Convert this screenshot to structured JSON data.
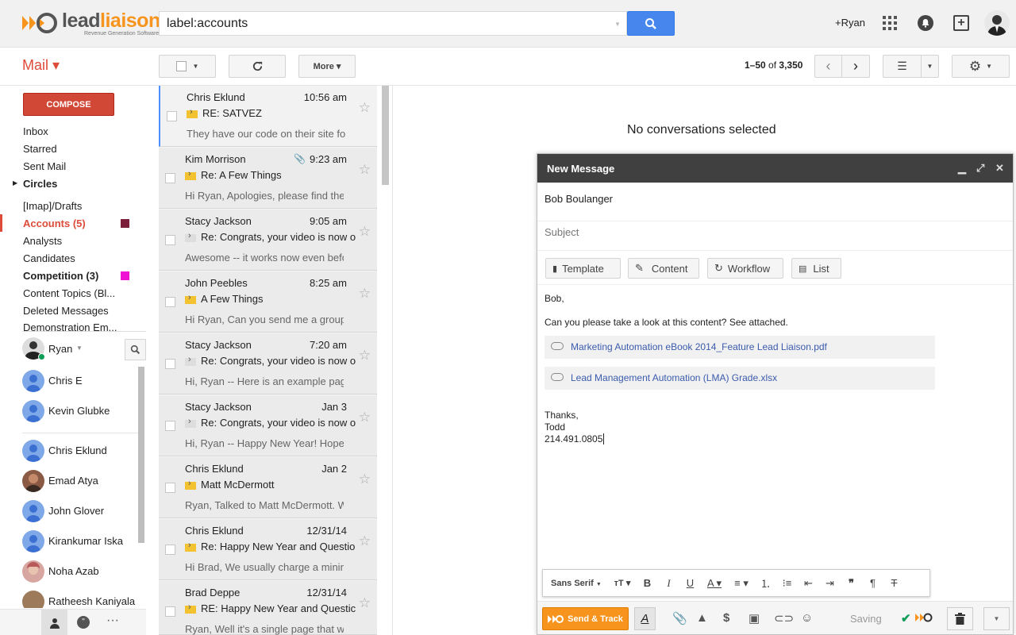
{
  "header": {
    "logo": {
      "brand_part1": "lead",
      "brand_part2": "liaison",
      "tagline": "Revenue Generation Software"
    },
    "search": {
      "value": "label:accounts"
    },
    "account_link": "+Ryan"
  },
  "toolbar": {
    "app_label": "Mail ▾",
    "more_label": "More ▾",
    "pager_range": "1–50",
    "pager_of": "of",
    "pager_total": "3,350"
  },
  "nav": {
    "compose_label": "COMPOSE",
    "items": [
      {
        "label": "Inbox"
      },
      {
        "label": "Starred"
      },
      {
        "label": "Sent Mail"
      },
      {
        "label": "Circles"
      },
      {
        "label": "[Imap]/Drafts"
      },
      {
        "label": "Accounts (5)",
        "color": "#7b1f3a"
      },
      {
        "label": "Analysts"
      },
      {
        "label": "Candidates"
      },
      {
        "label": "Competition (3)",
        "color": "#f012d2"
      },
      {
        "label": "Content Topics (Bl..."
      },
      {
        "label": "Deleted Messages"
      },
      {
        "label": "Demonstration Em..."
      }
    ]
  },
  "chat": {
    "self_name": "Ryan",
    "contacts": [
      {
        "name": "Chris E"
      },
      {
        "name": "Kevin Glubke"
      },
      {
        "name": "Chris Eklund"
      },
      {
        "name": "Emad Atya"
      },
      {
        "name": "John Glover"
      },
      {
        "name": "Kirankumar Iska"
      },
      {
        "name": "Noha Azab"
      },
      {
        "name": "Ratheesh Kaniyala"
      }
    ]
  },
  "messages": [
    {
      "from": "Chris Eklund",
      "time": "10:56 am",
      "subject": "RE: SATVEZ",
      "snippet": "They have our code on their site for"
    },
    {
      "from": "Kim Morrison",
      "time": "9:23 am",
      "subject": "Re: A Few Things",
      "snippet": "Hi Ryan, Apologies, please find the"
    },
    {
      "from": "Stacy Jackson",
      "time": "9:05 am",
      "subject": "Re: Congrats, your video is now o",
      "snippet": "Awesome -- it works now even befo"
    },
    {
      "from": "John Peebles",
      "time": "8:25 am",
      "subject": "A Few Things",
      "snippet": "Hi Ryan, Can you send me a group"
    },
    {
      "from": "Stacy Jackson",
      "time": "7:20 am",
      "subject": "Re: Congrats, your video is now o",
      "snippet": "Hi, Ryan -- Here is an example pag"
    },
    {
      "from": "Stacy Jackson",
      "time": "Jan 3",
      "subject": "Re: Congrats, your video is now o",
      "snippet": "Hi, Ryan -- Happy New Year! Hope"
    },
    {
      "from": "Chris Eklund",
      "time": "Jan 2",
      "subject": "Matt McDermott",
      "snippet": "Ryan, Talked to Matt McDermott. W"
    },
    {
      "from": "Chris Eklund",
      "time": "12/31/14",
      "subject": "Re: Happy New Year and Questio",
      "snippet": "Hi Brad, We usually charge a minin"
    },
    {
      "from": "Brad Deppe",
      "time": "12/31/14",
      "subject": "RE: Happy New Year and Questic",
      "snippet": "Ryan, Well it's a single page that w"
    }
  ],
  "reading_pane": {
    "empty_text": "No conversations selected"
  },
  "compose": {
    "title": "New Message",
    "to": "Bob Boulanger",
    "subject_placeholder": "Subject",
    "buttons": {
      "template": "Template",
      "content": "Content",
      "workflow": "Workflow",
      "list": "List"
    },
    "body": {
      "greeting": "Bob,",
      "line1": "Can you please take a look at this content? See attached.",
      "attachments": [
        {
          "name": "Marketing Automation eBook 2014_Feature Lead Liaison.pdf"
        },
        {
          "name": "Lead Management Automation (LMA) Grade.xlsx"
        }
      ],
      "signoff": "Thanks,",
      "sig_name": "Todd",
      "sig_phone": "214.491.0805"
    },
    "format": {
      "font": "Sans Serif"
    },
    "send_label": "Send & Track",
    "saving_label": "Saving"
  },
  "colors": {
    "accent_red": "#dd4b39",
    "accent_blue": "#4787ed",
    "brand_orange": "#f7941d"
  }
}
